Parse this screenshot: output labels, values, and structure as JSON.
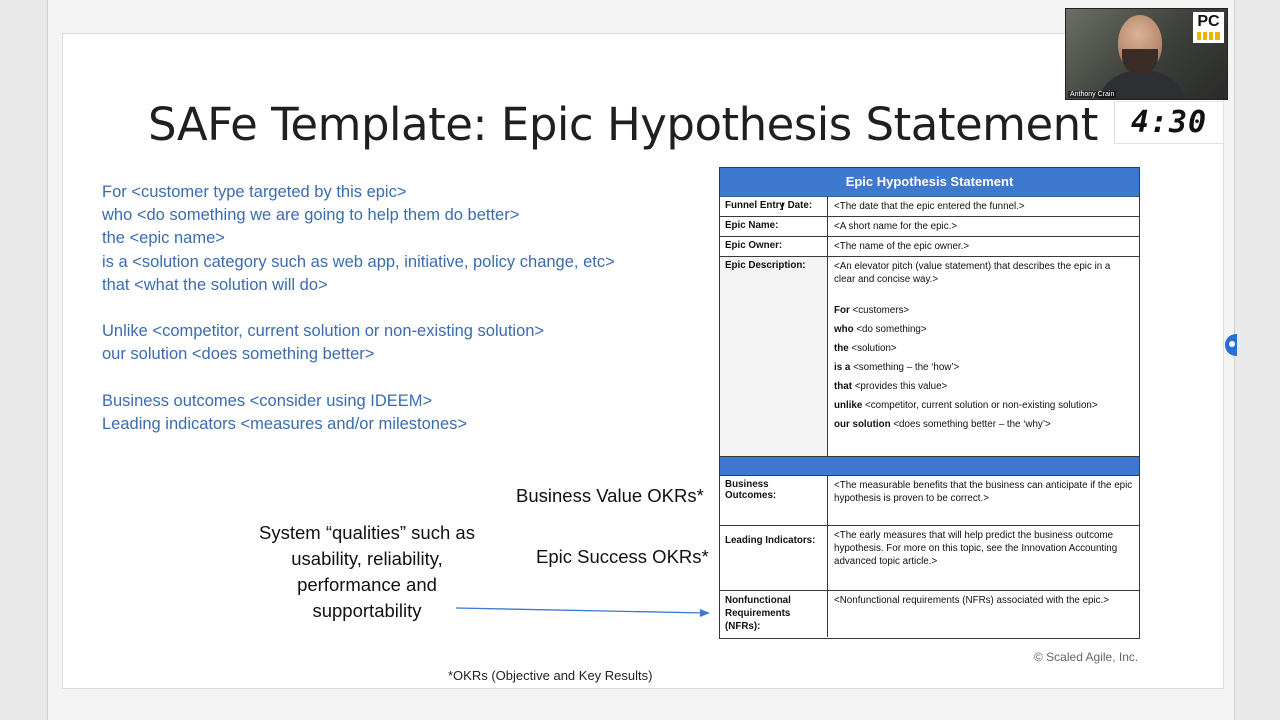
{
  "slide": {
    "title": "SAFe Template: Epic Hypothesis Statement",
    "left_text": [
      "For <customer type targeted by this epic>",
      "who <do something we are going to help them do better>",
      "the <epic name>",
      "is a <solution category such as web app, initiative, policy change, etc>",
      "that <what the solution will do>",
      "",
      "Unlike <competitor, current solution or non-existing solution>",
      "our solution <does something better>",
      "",
      "Business outcomes <consider using IDEEM>",
      "Leading indicators <measures and/or milestones>"
    ],
    "business_value_okrs": "Business Value OKRs*",
    "epic_success_okrs": "Epic Success OKRs*",
    "system_qualities": "System “qualities” such as usability, reliability, performance and supportability",
    "footnote": "*OKRs (Objective and Key Results)",
    "copyright": "© Scaled Agile, Inc."
  },
  "epic_table": {
    "header": "Epic Hypothesis Statement",
    "rows": {
      "funnel": {
        "label": "Funnel Entry Date:",
        "value": "<The date that the epic entered the funnel.>"
      },
      "name": {
        "label": "Epic Name:",
        "value": "<A short name for the epic.>"
      },
      "owner": {
        "label": "Epic Owner:",
        "value": "<The name of the epic owner.>"
      },
      "description": {
        "label": "Epic Description:",
        "intro": "<An elevator pitch (value statement) that describes the epic in a clear and concise way.>",
        "lines": [
          {
            "kw": "For",
            "text": " <customers>"
          },
          {
            "kw": "who",
            "text": " <do something>"
          },
          {
            "kw": "the",
            "text": " <solution>"
          },
          {
            "kw": "is a",
            "text": " <something – the ‘how’>"
          },
          {
            "kw": "that",
            "text": " <provides this value>"
          },
          {
            "kw": "unlike",
            "text": " <competitor, current solution or non-existing solution>"
          },
          {
            "kw": "our solution",
            "text": " <does something better – the ‘why’>"
          }
        ]
      },
      "business_outcomes": {
        "label": "Business Outcomes:",
        "value": "<The measurable benefits that the business can anticipate if the epic hypothesis is proven to be correct.>"
      },
      "leading_indicators": {
        "label": "Leading Indicators:",
        "value": "<The early measures that will help predict the business outcome hypothesis. For more on this topic, see the Innovation Accounting advanced topic article.>"
      },
      "nfrs": {
        "label": "Nonfunctional Requirements (NFRs):",
        "value": "<Nonfunctional requirements (NFRs) associated with the epic.>"
      }
    }
  },
  "webcam": {
    "name": "Anthony Crain",
    "logo": "PC"
  },
  "timer": "4:30",
  "colors": {
    "accent_blue": "#3e78cf",
    "body_text_blue": "#3b6cb0"
  }
}
